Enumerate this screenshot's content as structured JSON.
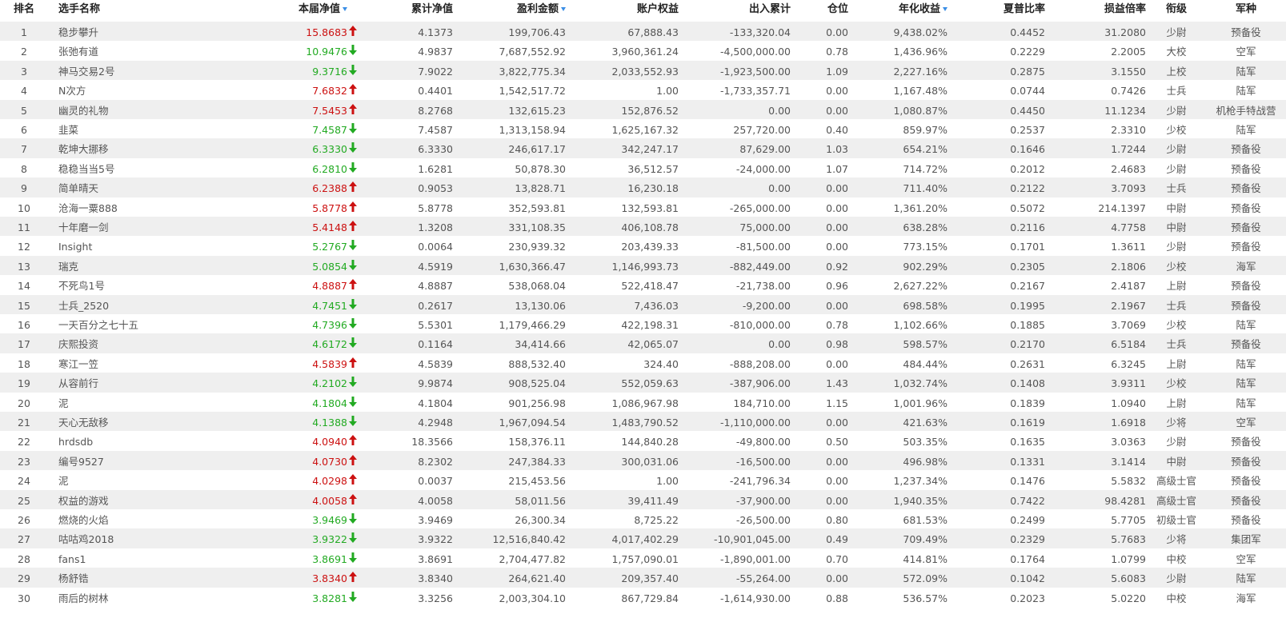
{
  "colors": {
    "up": "#cc1111",
    "down": "#22aa22",
    "sort": "#3a8ee6",
    "stripe": "#efefef"
  },
  "headers": {
    "rank": "排名",
    "name": "选手名称",
    "nav": "本届净值",
    "cum_nav": "累计净值",
    "profit": "盈利金额",
    "equity": "账户权益",
    "flow": "出入累计",
    "position": "仓位",
    "annual": "年化收益",
    "sharpe": "夏普比率",
    "pl_ratio": "损益倍率",
    "rank_title": "衔级",
    "branch": "军种"
  },
  "sorted_columns": [
    "nav",
    "profit",
    "annual"
  ],
  "rows": [
    {
      "rank": "1",
      "name": "稳步攀升",
      "nav": "15.8683",
      "trend": "up",
      "cum_nav": "4.1373",
      "profit": "199,706.43",
      "equity": "67,888.43",
      "flow": "-133,320.04",
      "position": "0.00",
      "annual": "9,438.02%",
      "sharpe": "0.4452",
      "pl_ratio": "31.2080",
      "rank_title": "少尉",
      "branch": "预备役"
    },
    {
      "rank": "2",
      "name": "张弛有道",
      "nav": "10.9476",
      "trend": "down",
      "cum_nav": "4.9837",
      "profit": "7,687,552.92",
      "equity": "3,960,361.24",
      "flow": "-4,500,000.00",
      "position": "0.78",
      "annual": "1,436.96%",
      "sharpe": "0.2229",
      "pl_ratio": "2.2005",
      "rank_title": "大校",
      "branch": "空军"
    },
    {
      "rank": "3",
      "name": "神马交易2号",
      "nav": "9.3716",
      "trend": "down",
      "cum_nav": "7.9022",
      "profit": "3,822,775.34",
      "equity": "2,033,552.93",
      "flow": "-1,923,500.00",
      "position": "1.09",
      "annual": "2,227.16%",
      "sharpe": "0.2875",
      "pl_ratio": "3.1550",
      "rank_title": "上校",
      "branch": "陆军"
    },
    {
      "rank": "4",
      "name": "N次方",
      "nav": "7.6832",
      "trend": "up",
      "cum_nav": "0.4401",
      "profit": "1,542,517.72",
      "equity": "1.00",
      "flow": "-1,733,357.71",
      "position": "0.00",
      "annual": "1,167.48%",
      "sharpe": "0.0744",
      "pl_ratio": "0.7426",
      "rank_title": "士兵",
      "branch": "陆军"
    },
    {
      "rank": "5",
      "name": "幽灵的礼物",
      "nav": "7.5453",
      "trend": "up",
      "cum_nav": "8.2768",
      "profit": "132,615.23",
      "equity": "152,876.52",
      "flow": "0.00",
      "position": "0.00",
      "annual": "1,080.87%",
      "sharpe": "0.4450",
      "pl_ratio": "11.1234",
      "rank_title": "少尉",
      "branch": "机枪手特战营"
    },
    {
      "rank": "6",
      "name": "韭菜",
      "nav": "7.4587",
      "trend": "down",
      "cum_nav": "7.4587",
      "profit": "1,313,158.94",
      "equity": "1,625,167.32",
      "flow": "257,720.00",
      "position": "0.40",
      "annual": "859.97%",
      "sharpe": "0.2537",
      "pl_ratio": "2.3310",
      "rank_title": "少校",
      "branch": "陆军"
    },
    {
      "rank": "7",
      "name": "乾坤大挪移",
      "nav": "6.3330",
      "trend": "down",
      "cum_nav": "6.3330",
      "profit": "246,617.17",
      "equity": "342,247.17",
      "flow": "87,629.00",
      "position": "1.03",
      "annual": "654.21%",
      "sharpe": "0.1646",
      "pl_ratio": "1.7244",
      "rank_title": "少尉",
      "branch": "预备役"
    },
    {
      "rank": "8",
      "name": "稳稳当当5号",
      "nav": "6.2810",
      "trend": "down",
      "cum_nav": "1.6281",
      "profit": "50,878.30",
      "equity": "36,512.57",
      "flow": "-24,000.00",
      "position": "1.07",
      "annual": "714.72%",
      "sharpe": "0.2012",
      "pl_ratio": "2.4683",
      "rank_title": "少尉",
      "branch": "预备役"
    },
    {
      "rank": "9",
      "name": "简单晴天",
      "nav": "6.2388",
      "trend": "up",
      "cum_nav": "0.9053",
      "profit": "13,828.71",
      "equity": "16,230.18",
      "flow": "0.00",
      "position": "0.00",
      "annual": "711.40%",
      "sharpe": "0.2122",
      "pl_ratio": "3.7093",
      "rank_title": "士兵",
      "branch": "预备役"
    },
    {
      "rank": "10",
      "name": "沧海一粟888",
      "nav": "5.8778",
      "trend": "up",
      "cum_nav": "5.8778",
      "profit": "352,593.81",
      "equity": "132,593.81",
      "flow": "-265,000.00",
      "position": "0.00",
      "annual": "1,361.20%",
      "sharpe": "0.5072",
      "pl_ratio": "214.1397",
      "rank_title": "中尉",
      "branch": "预备役"
    },
    {
      "rank": "11",
      "name": "十年磨一剑",
      "nav": "5.4148",
      "trend": "up",
      "cum_nav": "1.3208",
      "profit": "331,108.35",
      "equity": "406,108.78",
      "flow": "75,000.00",
      "position": "0.00",
      "annual": "638.28%",
      "sharpe": "0.2116",
      "pl_ratio": "4.7758",
      "rank_title": "中尉",
      "branch": "预备役"
    },
    {
      "rank": "12",
      "name": "Insight",
      "nav": "5.2767",
      "trend": "down",
      "cum_nav": "0.0064",
      "profit": "230,939.32",
      "equity": "203,439.33",
      "flow": "-81,500.00",
      "position": "0.00",
      "annual": "773.15%",
      "sharpe": "0.1701",
      "pl_ratio": "1.3611",
      "rank_title": "少尉",
      "branch": "预备役"
    },
    {
      "rank": "13",
      "name": "瑞克",
      "nav": "5.0854",
      "trend": "down",
      "cum_nav": "4.5919",
      "profit": "1,630,366.47",
      "equity": "1,146,993.73",
      "flow": "-882,449.00",
      "position": "0.92",
      "annual": "902.29%",
      "sharpe": "0.2305",
      "pl_ratio": "2.1806",
      "rank_title": "少校",
      "branch": "海军"
    },
    {
      "rank": "14",
      "name": "不死鸟1号",
      "nav": "4.8887",
      "trend": "up",
      "cum_nav": "4.8887",
      "profit": "538,068.04",
      "equity": "522,418.47",
      "flow": "-21,738.00",
      "position": "0.96",
      "annual": "2,627.22%",
      "sharpe": "0.2167",
      "pl_ratio": "2.4187",
      "rank_title": "上尉",
      "branch": "预备役"
    },
    {
      "rank": "15",
      "name": "士兵_2520",
      "nav": "4.7451",
      "trend": "down",
      "cum_nav": "0.2617",
      "profit": "13,130.06",
      "equity": "7,436.03",
      "flow": "-9,200.00",
      "position": "0.00",
      "annual": "698.58%",
      "sharpe": "0.1995",
      "pl_ratio": "2.1967",
      "rank_title": "士兵",
      "branch": "预备役"
    },
    {
      "rank": "16",
      "name": "一天百分之七十五",
      "nav": "4.7396",
      "trend": "down",
      "cum_nav": "5.5301",
      "profit": "1,179,466.29",
      "equity": "422,198.31",
      "flow": "-810,000.00",
      "position": "0.78",
      "annual": "1,102.66%",
      "sharpe": "0.1885",
      "pl_ratio": "3.7069",
      "rank_title": "少校",
      "branch": "陆军"
    },
    {
      "rank": "17",
      "name": "庆熙投资",
      "nav": "4.6172",
      "trend": "down",
      "cum_nav": "0.1164",
      "profit": "34,414.66",
      "equity": "42,065.07",
      "flow": "0.00",
      "position": "0.98",
      "annual": "598.57%",
      "sharpe": "0.2170",
      "pl_ratio": "6.5184",
      "rank_title": "士兵",
      "branch": "预备役"
    },
    {
      "rank": "18",
      "name": "寒江一笠",
      "nav": "4.5839",
      "trend": "up",
      "cum_nav": "4.5839",
      "profit": "888,532.40",
      "equity": "324.40",
      "flow": "-888,208.00",
      "position": "0.00",
      "annual": "484.44%",
      "sharpe": "0.2631",
      "pl_ratio": "6.3245",
      "rank_title": "上尉",
      "branch": "陆军"
    },
    {
      "rank": "19",
      "name": "从容前行",
      "nav": "4.2102",
      "trend": "down",
      "cum_nav": "9.9874",
      "profit": "908,525.04",
      "equity": "552,059.63",
      "flow": "-387,906.00",
      "position": "1.43",
      "annual": "1,032.74%",
      "sharpe": "0.1408",
      "pl_ratio": "3.9311",
      "rank_title": "少校",
      "branch": "陆军"
    },
    {
      "rank": "20",
      "name": "泥",
      "nav": "4.1804",
      "trend": "down",
      "cum_nav": "4.1804",
      "profit": "901,256.98",
      "equity": "1,086,967.98",
      "flow": "184,710.00",
      "position": "1.15",
      "annual": "1,001.96%",
      "sharpe": "0.1839",
      "pl_ratio": "1.0940",
      "rank_title": "上尉",
      "branch": "陆军"
    },
    {
      "rank": "21",
      "name": "天心无敌移",
      "nav": "4.1388",
      "trend": "down",
      "cum_nav": "4.2948",
      "profit": "1,967,094.54",
      "equity": "1,483,790.52",
      "flow": "-1,110,000.00",
      "position": "0.00",
      "annual": "421.63%",
      "sharpe": "0.1619",
      "pl_ratio": "1.6918",
      "rank_title": "少将",
      "branch": "空军"
    },
    {
      "rank": "22",
      "name": "hrdsdb",
      "nav": "4.0940",
      "trend": "up",
      "cum_nav": "18.3566",
      "profit": "158,376.11",
      "equity": "144,840.28",
      "flow": "-49,800.00",
      "position": "0.50",
      "annual": "503.35%",
      "sharpe": "0.1635",
      "pl_ratio": "3.0363",
      "rank_title": "少尉",
      "branch": "预备役"
    },
    {
      "rank": "23",
      "name": "编号9527",
      "nav": "4.0730",
      "trend": "up",
      "cum_nav": "8.2302",
      "profit": "247,384.33",
      "equity": "300,031.06",
      "flow": "-16,500.00",
      "position": "0.00",
      "annual": "496.98%",
      "sharpe": "0.1331",
      "pl_ratio": "3.1414",
      "rank_title": "中尉",
      "branch": "预备役"
    },
    {
      "rank": "24",
      "name": "泥",
      "nav": "4.0298",
      "trend": "up",
      "cum_nav": "0.0037",
      "profit": "215,453.56",
      "equity": "1.00",
      "flow": "-241,796.34",
      "position": "0.00",
      "annual": "1,237.34%",
      "sharpe": "0.1476",
      "pl_ratio": "5.5832",
      "rank_title": "高级士官",
      "branch": "预备役"
    },
    {
      "rank": "25",
      "name": "权益的游戏",
      "nav": "4.0058",
      "trend": "up",
      "cum_nav": "4.0058",
      "profit": "58,011.56",
      "equity": "39,411.49",
      "flow": "-37,900.00",
      "position": "0.00",
      "annual": "1,940.35%",
      "sharpe": "0.7422",
      "pl_ratio": "98.4281",
      "rank_title": "高级士官",
      "branch": "预备役"
    },
    {
      "rank": "26",
      "name": "燃烧的火焰",
      "nav": "3.9469",
      "trend": "down",
      "cum_nav": "3.9469",
      "profit": "26,300.34",
      "equity": "8,725.22",
      "flow": "-26,500.00",
      "position": "0.80",
      "annual": "681.53%",
      "sharpe": "0.2499",
      "pl_ratio": "5.7705",
      "rank_title": "初级士官",
      "branch": "预备役"
    },
    {
      "rank": "27",
      "name": "咕咕鸡2018",
      "nav": "3.9322",
      "trend": "down",
      "cum_nav": "3.9322",
      "profit": "12,516,840.42",
      "equity": "4,017,402.29",
      "flow": "-10,901,045.00",
      "position": "0.49",
      "annual": "709.49%",
      "sharpe": "0.2329",
      "pl_ratio": "5.7683",
      "rank_title": "少将",
      "branch": "集团军"
    },
    {
      "rank": "28",
      "name": "fans1",
      "nav": "3.8691",
      "trend": "down",
      "cum_nav": "3.8691",
      "profit": "2,704,477.82",
      "equity": "1,757,090.01",
      "flow": "-1,890,001.00",
      "position": "0.70",
      "annual": "414.81%",
      "sharpe": "0.1764",
      "pl_ratio": "1.0799",
      "rank_title": "中校",
      "branch": "空军"
    },
    {
      "rank": "29",
      "name": "杨舒锆",
      "nav": "3.8340",
      "trend": "up",
      "cum_nav": "3.8340",
      "profit": "264,621.40",
      "equity": "209,357.40",
      "flow": "-55,264.00",
      "position": "0.00",
      "annual": "572.09%",
      "sharpe": "0.1042",
      "pl_ratio": "5.6083",
      "rank_title": "少尉",
      "branch": "陆军"
    },
    {
      "rank": "30",
      "name": "雨后的树林",
      "nav": "3.8281",
      "trend": "down",
      "cum_nav": "3.3256",
      "profit": "2,003,304.10",
      "equity": "867,729.84",
      "flow": "-1,614,930.00",
      "position": "0.88",
      "annual": "536.57%",
      "sharpe": "0.2023",
      "pl_ratio": "5.0220",
      "rank_title": "中校",
      "branch": "海军"
    }
  ]
}
